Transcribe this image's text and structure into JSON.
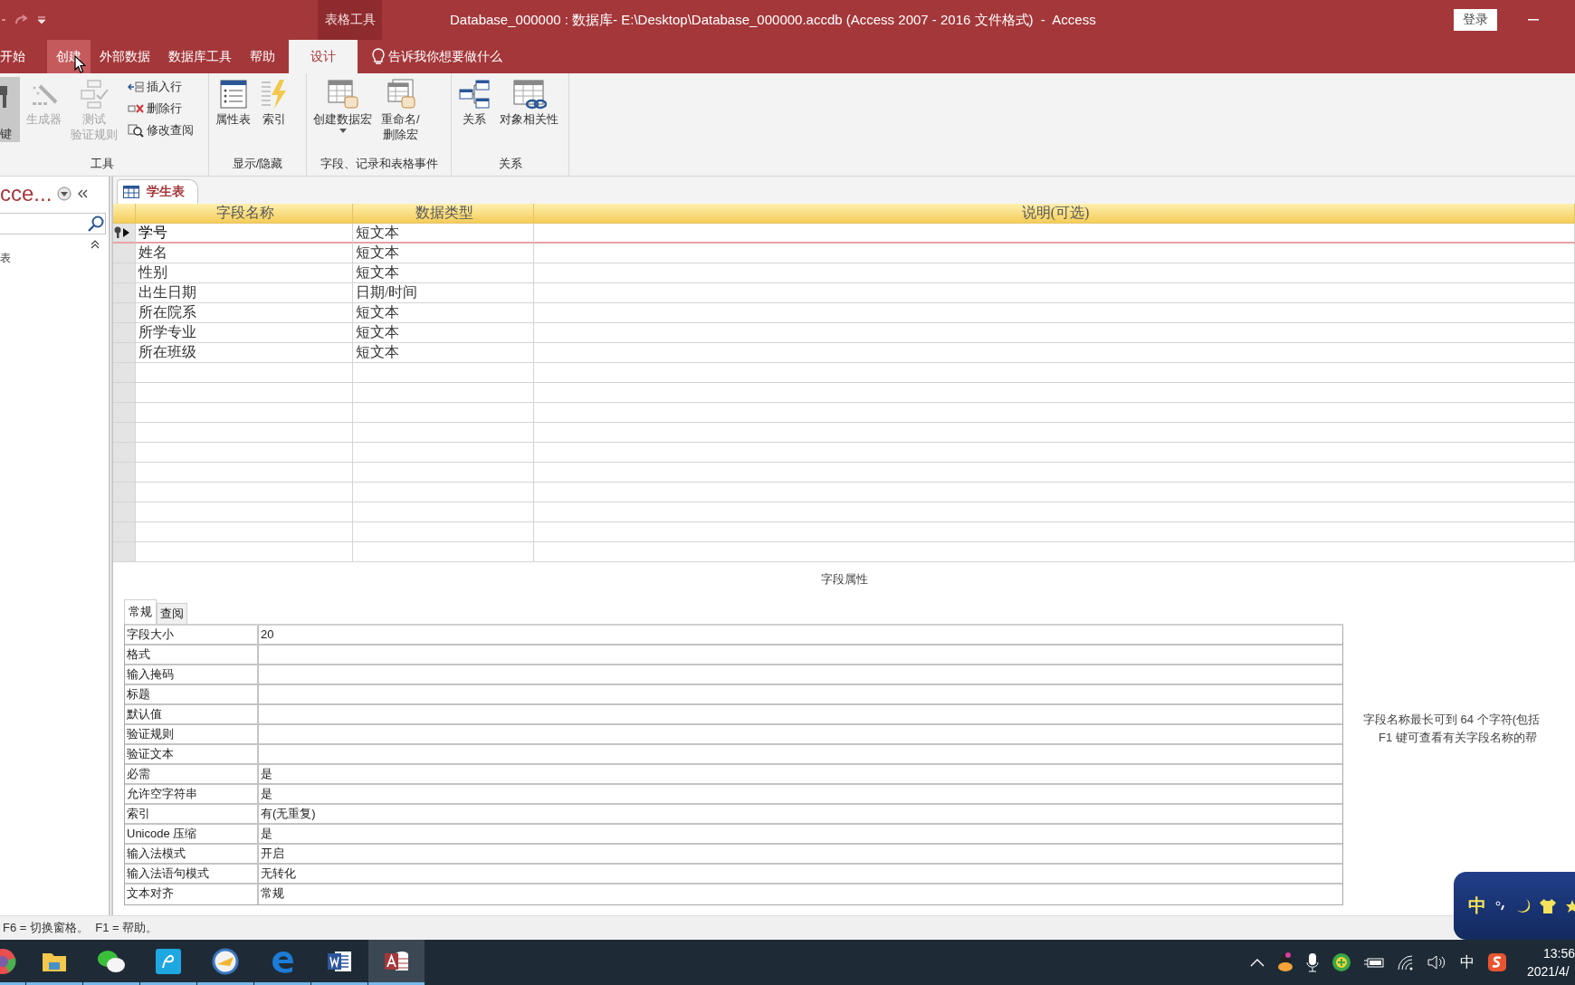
{
  "title_bar": {
    "context_tab": "表格工具",
    "title": "Database_000000 : 数据库- E:\\Desktop\\Database_000000.accdb (Access 2007 - 2016 文件格式)  -  Access",
    "sign_in": "登录"
  },
  "ribbon_tabs": [
    {
      "label": "开始",
      "selected": false,
      "hovered": false
    },
    {
      "label": "创建",
      "selected": false,
      "hovered": true
    },
    {
      "label": "外部数据",
      "selected": false,
      "hovered": false
    },
    {
      "label": "数据库工具",
      "selected": false,
      "hovered": false
    },
    {
      "label": "帮助",
      "selected": false,
      "hovered": false
    },
    {
      "label": "设计",
      "selected": true,
      "hovered": false
    }
  ],
  "tell_me": "告诉我你想要做什么",
  "ribbon_groups": [
    {
      "label": "工具",
      "buttons": [
        {
          "kind": "clipped",
          "lines": [
            "键"
          ],
          "pressed": true,
          "disabled": false
        },
        {
          "kind": "large",
          "lines": [
            "生成器"
          ],
          "pressed": false,
          "disabled": true
        },
        {
          "kind": "large",
          "lines": [
            "测试",
            "验证规则"
          ],
          "pressed": false,
          "disabled": true
        },
        {
          "kind": "small",
          "lines": [
            "插入行"
          ],
          "pressed": false,
          "disabled": false
        },
        {
          "kind": "small",
          "lines": [
            "删除行"
          ],
          "pressed": false,
          "disabled": false
        },
        {
          "kind": "small",
          "lines": [
            "修改查阅"
          ],
          "pressed": false,
          "disabled": false
        }
      ]
    },
    {
      "label": "显示/隐藏",
      "buttons": [
        {
          "kind": "large",
          "lines": [
            "属性表"
          ],
          "pressed": false,
          "disabled": false
        },
        {
          "kind": "large",
          "lines": [
            "索引"
          ],
          "pressed": false,
          "disabled": false
        }
      ]
    },
    {
      "label": "字段、记录和表格事件",
      "buttons": [
        {
          "kind": "large",
          "lines": [
            "创建数据宏"
          ],
          "pressed": false,
          "disabled": false,
          "dropdown": true
        },
        {
          "kind": "large",
          "lines": [
            "重命名/",
            "删除宏"
          ],
          "pressed": false,
          "disabled": false
        }
      ]
    },
    {
      "label": "关系",
      "buttons": [
        {
          "kind": "large",
          "lines": [
            "关系"
          ],
          "pressed": false,
          "disabled": false
        },
        {
          "kind": "large",
          "lines": [
            "对象相关性"
          ],
          "pressed": false,
          "disabled": false
        }
      ]
    }
  ],
  "navigation": {
    "title": "cce...",
    "group": "表"
  },
  "document_tab": {
    "label": "学生表"
  },
  "design_grid": {
    "columns": [
      "字段名称",
      "数据类型",
      "说明(可选)"
    ],
    "rows": [
      {
        "name": "学号",
        "type": "短文本",
        "primary_key": true,
        "selected": true
      },
      {
        "name": "姓名",
        "type": "短文本",
        "primary_key": false,
        "selected": false
      },
      {
        "name": "性别",
        "type": "短文本",
        "primary_key": false,
        "selected": false
      },
      {
        "name": "出生日期",
        "type": "日期/时间",
        "primary_key": false,
        "selected": false
      },
      {
        "name": "所在院系",
        "type": "短文本",
        "primary_key": false,
        "selected": false
      },
      {
        "name": "所学专业",
        "type": "短文本",
        "primary_key": false,
        "selected": false
      },
      {
        "name": "所在班级",
        "type": "短文本",
        "primary_key": false,
        "selected": false
      }
    ]
  },
  "field_properties": {
    "heading": "字段属性",
    "tabs": [
      {
        "label": "常规",
        "selected": true
      },
      {
        "label": "查阅",
        "selected": false
      }
    ],
    "rows": [
      {
        "label": "字段大小",
        "value": "20"
      },
      {
        "label": "格式"
      },
      {
        "label": "输入掩码"
      },
      {
        "label": "标题"
      },
      {
        "label": "默认值"
      },
      {
        "label": "验证规则"
      },
      {
        "label": "验证文本"
      },
      {
        "label": "必需",
        "value": "是"
      },
      {
        "label": "允许空字符串",
        "value": "是"
      },
      {
        "label": "索引",
        "value": "有(无重复)"
      },
      {
        "label": "Unicode 压缩",
        "value": "是"
      },
      {
        "label": "输入法模式",
        "value": "开启"
      },
      {
        "label": "输入法语句模式",
        "value": "无转化"
      },
      {
        "label": "文本对齐",
        "value": "常规"
      }
    ],
    "help": [
      "字段名称最长可到 64 个字符(包括",
      "F1 键可查看有关字段名称的帮"
    ]
  },
  "status_bar": "F6 = 切换窗格。  F1 = 帮助。",
  "taskbar": {
    "apps": [
      {
        "selected": false
      },
      {
        "selected": false
      },
      {
        "selected": false
      },
      {
        "selected": false
      },
      {
        "selected": false
      },
      {
        "selected": false
      },
      {
        "selected": false
      },
      {
        "selected": true
      }
    ],
    "ime_indicator": "中",
    "clock": "13:56",
    "date": "2021/4/"
  },
  "ime_toolbar": {
    "mode": "中"
  }
}
